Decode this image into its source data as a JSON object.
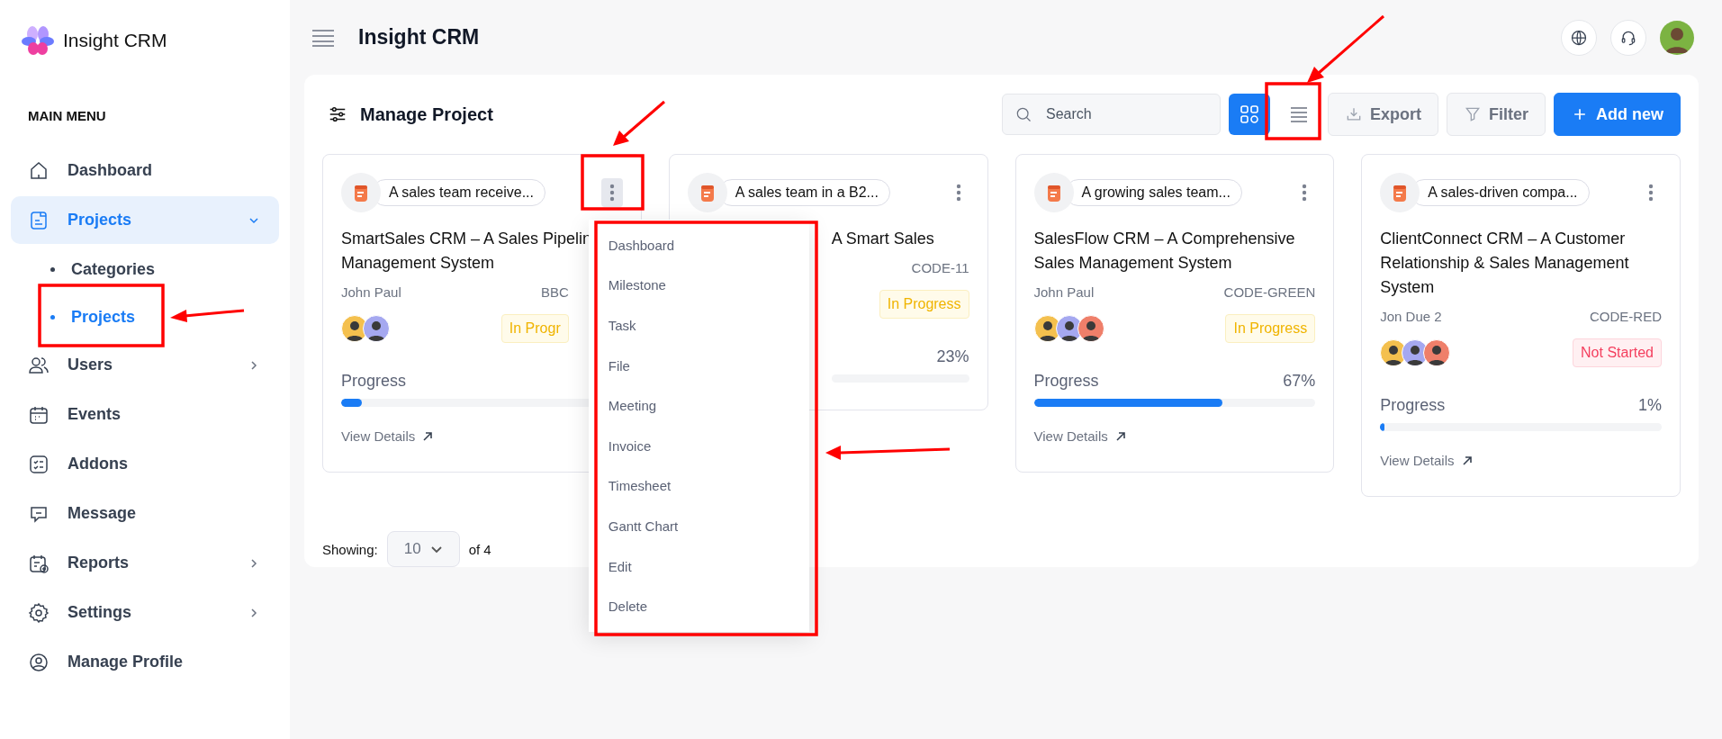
{
  "brand": {
    "name": "Insight CRM"
  },
  "sidebar": {
    "section": "MAIN MENU",
    "items": [
      {
        "label": "Dashboard",
        "selected": false,
        "expandable": false
      },
      {
        "label": "Projects",
        "selected": true,
        "expandable": true,
        "expanded": true,
        "children": [
          {
            "label": "Categories",
            "selected": false
          },
          {
            "label": "Projects",
            "selected": true
          }
        ]
      },
      {
        "label": "Users",
        "selected": false,
        "expandable": true,
        "expanded": false
      },
      {
        "label": "Events",
        "selected": false,
        "expandable": false
      },
      {
        "label": "Addons",
        "selected": false,
        "expandable": false
      },
      {
        "label": "Message",
        "selected": false,
        "expandable": false
      },
      {
        "label": "Reports",
        "selected": false,
        "expandable": true,
        "expanded": false
      },
      {
        "label": "Settings",
        "selected": false,
        "expandable": true,
        "expanded": false
      },
      {
        "label": "Manage Profile",
        "selected": false,
        "expandable": false
      }
    ]
  },
  "header": {
    "title": "Insight CRM"
  },
  "panel": {
    "title": "Manage Project",
    "search": {
      "placeholder": "Search"
    },
    "views": [
      {
        "kind": "grid",
        "selected": true
      },
      {
        "kind": "list",
        "selected": false
      }
    ],
    "buttons": [
      {
        "label": "Export",
        "kind": "export"
      },
      {
        "label": "Filter",
        "kind": "filter"
      },
      {
        "label": "Add new",
        "kind": "add"
      }
    ]
  },
  "cards": [
    {
      "tag": "A sales team receive...",
      "menu_open": true,
      "title": [
        "SmartSales CRM – A Sales Pipelin",
        "Management System"
      ],
      "owner": "John Paul",
      "code": "BBC",
      "members": [
        {
          "color": "#f4c04e"
        },
        {
          "color": "#a5a8f0"
        }
      ],
      "status": {
        "label": "In Progr",
        "kind": "in_progress"
      },
      "progress_label": "Progress",
      "level": 0.08,
      "link": "View Details"
    },
    {
      "tag": "A sales team in a B2...",
      "menu_open": false,
      "title": [
        "A Smart Sales"
      ],
      "code": "CODE-11",
      "status": {
        "label": "In Progress",
        "kind": "in_progress"
      },
      "percent": "23%"
    },
    {
      "tag": "A growing sales team...",
      "menu_open": false,
      "title": [
        "SalesFlow CRM – A Comprehensive",
        "Sales Management System"
      ],
      "owner": "John Paul",
      "code": "CODE-GREEN",
      "members": [
        {
          "color": "#f4c04e"
        },
        {
          "color": "#a5a8f0"
        },
        {
          "color": "#ef7f6a"
        }
      ],
      "status": {
        "label": "In Progress",
        "kind": "in_progress"
      },
      "progress_label": "Progress",
      "percent": "67%",
      "level": 0.67,
      "link": "View Details"
    },
    {
      "tag": "A sales-driven compa...",
      "menu_open": false,
      "title": [
        "ClientConnect CRM – A Customer",
        "Relationship & Sales Management",
        "System"
      ],
      "owner": "Jon Due 2",
      "code": "CODE-RED",
      "members": [
        {
          "color": "#f4c04e"
        },
        {
          "color": "#a5a8f0"
        },
        {
          "color": "#ef7f6a"
        }
      ],
      "status": {
        "label": "Not Started",
        "kind": "not_started"
      },
      "progress_label": "Progress",
      "percent": "1%",
      "level": 0.01,
      "link": "View Details"
    }
  ],
  "menu": {
    "items": [
      "Dashboard",
      "Milestone",
      "Task",
      "File",
      "Meeting",
      "Invoice",
      "Timesheet",
      "Gantt Chart",
      "Edit",
      "Delete"
    ]
  },
  "pagination": {
    "label": "Showing:",
    "page_size": "10",
    "total": "of 4"
  }
}
